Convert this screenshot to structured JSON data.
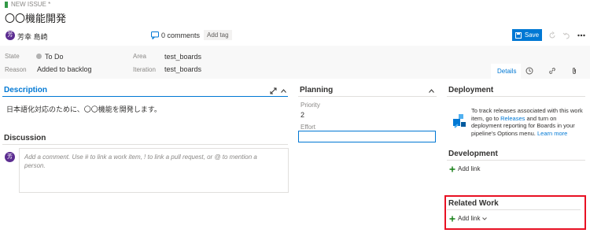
{
  "header": {
    "badge": "NEW ISSUE *",
    "title": "〇〇機能開発",
    "assignee": "芳幸 島崎",
    "avatar_initial": "芳",
    "comments": "0 comments",
    "add_tag": "Add tag",
    "save": "Save"
  },
  "fields": {
    "state_label": "State",
    "state_value": "To Do",
    "reason_label": "Reason",
    "reason_value": "Added to backlog",
    "area_label": "Area",
    "area_value": "test_boards",
    "iteration_label": "Iteration",
    "iteration_value": "test_boards"
  },
  "tabs": {
    "details": "Details"
  },
  "description": {
    "title": "Description",
    "text": "日本語化対応のために、〇〇機能を開発します。"
  },
  "discussion": {
    "title": "Discussion",
    "avatar_initial": "芳",
    "placeholder": "Add a comment. Use # to link a work item, ! to link a pull request, or @ to mention a person."
  },
  "planning": {
    "title": "Planning",
    "priority_label": "Priority",
    "priority_value": "2",
    "effort_label": "Effort",
    "effort_value": ""
  },
  "deployment": {
    "title": "Deployment",
    "text_1": "To track releases associated with this work item, go to ",
    "releases_link": "Releases",
    "text_2": " and turn on deployment reporting for Boards in your pipeline's Options menu. ",
    "learn_more": "Learn more"
  },
  "development": {
    "title": "Development",
    "add_link": "Add link"
  },
  "related_work": {
    "title": "Related Work",
    "add_link": "Add link"
  },
  "colors": {
    "accent": "#0078d4",
    "state_dot": "#b2b2b2",
    "avatar": "#5c2d91",
    "highlight_box": "#e81123",
    "add_green": "#107c10"
  }
}
